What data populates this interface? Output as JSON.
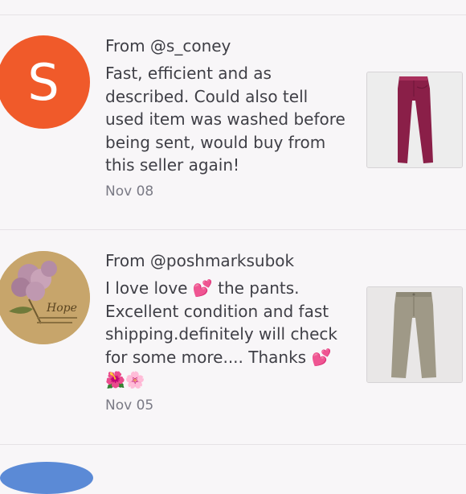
{
  "reviews": [
    {
      "from_prefix": "From ",
      "username": "@s_coney",
      "avatar_letter": "S",
      "avatar_color": "#f05a2a",
      "text": "Fast, efficient and as described. Could also tell used item was washed before being sent, would buy from this seller again!",
      "date": "Nov 08",
      "item_icon": "maroon-pants-thumbnail"
    },
    {
      "from_prefix": "From ",
      "username": "@poshmarksubok",
      "avatar_icon": "hydrangea-hope-avatar",
      "avatar_text": "Hope",
      "text_part1": "I love love ",
      "text_part2": " the pants. Excellent condition and fast shipping.definitely will check for some more.... Thanks ",
      "emoji_heart": "💕",
      "emoji_flowers": "🌺🌸",
      "date": "Nov 05",
      "item_icon": "khaki-pants-thumbnail"
    }
  ],
  "colors": {
    "background": "#f8f6f8",
    "text": "#3f3f46",
    "date": "#7a7a85",
    "divider": "#e6e2e6",
    "accent_pink": "#e1308a"
  }
}
